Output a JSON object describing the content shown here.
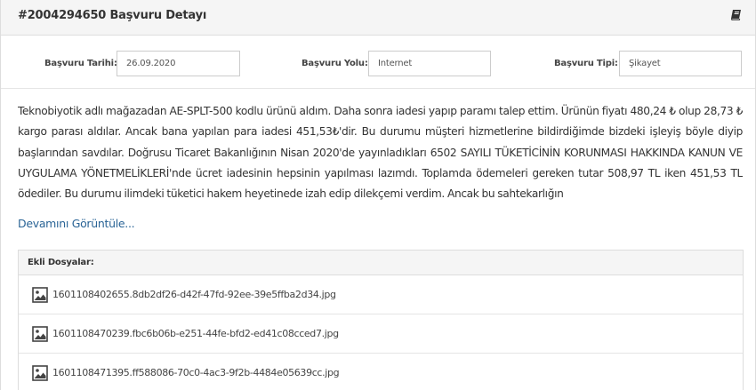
{
  "header": {
    "title": "#2004294650 Başvuru Detayı",
    "icon": "book-icon"
  },
  "fields": [
    {
      "label": "Başvuru Tarihi:",
      "value": "26.09.2020"
    },
    {
      "label": "Başvuru Yolu:",
      "value": "İnternet"
    },
    {
      "label": "Başvuru Tipi:",
      "value": "Şikayet"
    }
  ],
  "complaint": {
    "text": "Teknobiyotik adlı mağazadan AE-SPLT-500 kodlu ürünü aldım. Daha sonra iadesi yapıp paramı talep ettim. Ürünün fiyatı 480,24 ₺ olup 28,73 ₺ kargo parası aldılar. Ancak bana yapılan para iadesi 451,53₺'dir. Bu durumu müşteri hizmetlerine bildirdiğimde bizdeki işleyiş böyle diyip başlarından savdılar. Doğrusu Ticaret Bakanlığının Nisan 2020'de yayınladıkları 6502 SAYILI TÜKETİCİNİN KORUNMASI HAKKINDA KANUN VE UYGULAMA YÖNETMELİKLERİ'nde ücret iadesinin hepsinin yapılması lazımdı. Toplamda ödemeleri gereken tutar 508,97 TL iken 451,53 TL ödediler. Bu durumu ilimdeki tüketici hakem heyetinede izah edip dilekçemi verdim. Ancak bu sahtekarlığın",
    "more_label": "Devamını Görüntüle..."
  },
  "attachments": {
    "title": "Ekli Dosyalar:",
    "icon": "image-file-icon",
    "files": [
      "1601108402655.8db2df26-d42f-47fd-92ee-39e5ffba2d34.jpg",
      "1601108470239.fbc6b06b-e251-44fe-bfd2-ed41c08cced7.jpg",
      "1601108471395.ff588086-70c0-4ac3-9f2b-4484e05639cc.jpg"
    ]
  }
}
